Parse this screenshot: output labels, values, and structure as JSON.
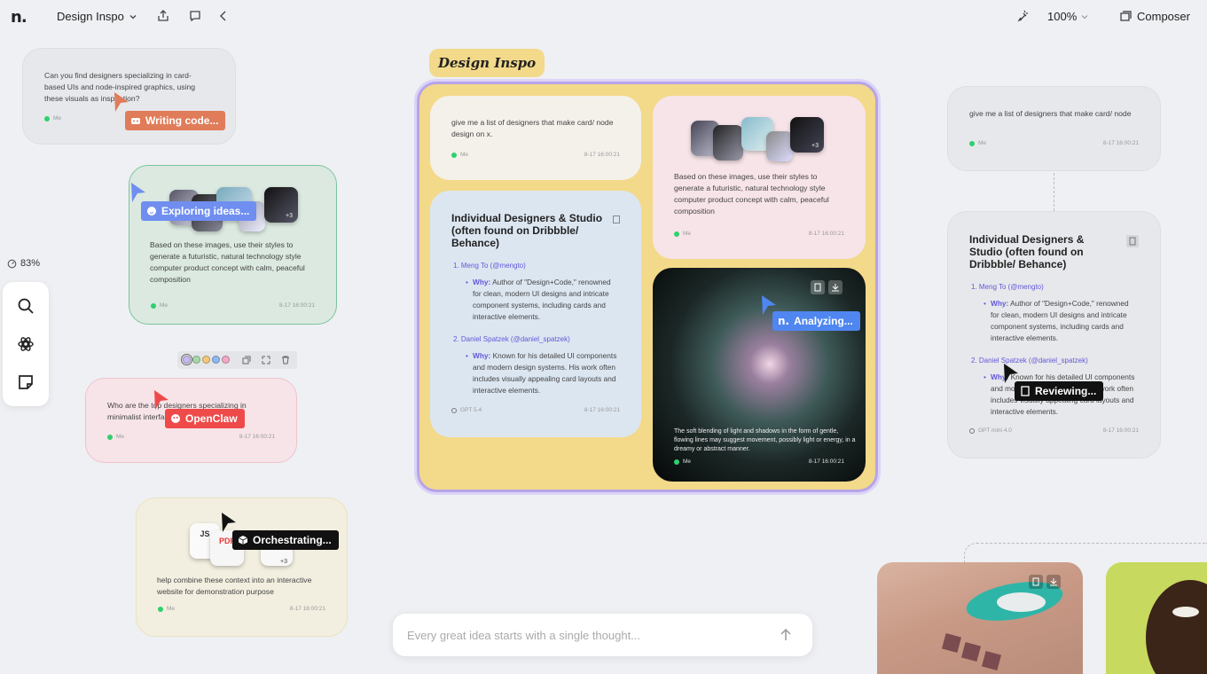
{
  "app": {
    "logo": "n.",
    "title": "Design Inspo"
  },
  "toolbar": {
    "zoom": "100%",
    "composer_label": "Composer"
  },
  "sidebar": {
    "zoom_percent": "83%"
  },
  "swatches": [
    "#c8b9f2",
    "#a8d8a8",
    "#f2c879",
    "#8fb8f0",
    "#f2a7c4"
  ],
  "cards": {
    "writing": {
      "text": "Can you find designers specializing in card-based UIs and node-inspired graphics, using these visuals as inspiration?",
      "author": "Me",
      "status": "Writing code..."
    },
    "exploring": {
      "text": "Based on these images, use their styles to generate a futuristic, natural technology style computer product concept with calm, peaceful composition",
      "author": "Me",
      "time": "8-17 16:00:21",
      "status": "Exploring ideas...",
      "more": "+3"
    },
    "openclaw": {
      "text": "Who are the top designers specializing in minimalist interfaces",
      "author": "Me",
      "time": "8-17 16:00:21",
      "status": "OpenClaw"
    },
    "orchestrating": {
      "text": "help combine these context into an interactive website for demonstration purpose",
      "author": "Me",
      "time": "8-17 16:00:21",
      "status": "Orchestrating...",
      "file1": "JS",
      "file2": "PDF",
      "more": "+3"
    }
  },
  "group": {
    "label": "Design Inspo",
    "prompt": {
      "text": "give me a list of designers that make card/ node design on x.",
      "author": "Me",
      "time": "8-17 16:00:21"
    },
    "answer": {
      "heading": "Individual Designers & Studio (often found on Dribbble/ Behance)",
      "items": [
        {
          "name": "1. Meng To (@mengto)",
          "why": "Why:",
          "text": "Author of \"Design+Code,\" renowned for clean, modern UI designs and intricate component systems, including cards and interactive elements."
        },
        {
          "name": "2. Daniel Spatzek (@daniel_spatzek)",
          "why": "Why:",
          "text": "Known for his detailed UI components and modern design systems. His work often includes visually appealing card layouts and interactive elements."
        }
      ],
      "model": "GPT 5.4",
      "time": "8-17 16:00:21"
    },
    "images_prompt": {
      "text": "Based on these images, use their styles to generate a futuristic, natural technology style computer product concept with calm, peaceful composition",
      "author": "Me",
      "time": "8-17 16:00:21",
      "more": "+3"
    },
    "image_result": {
      "caption": "The soft blending of light and shadows in the form of gentle, flowing lines may suggest movement, possibly light or energy, in a dreamy or abstract manner.",
      "author": "Me",
      "time": "8-17 16:00:21",
      "status": "Analyzing..."
    }
  },
  "right": {
    "prompt": {
      "text": "give me a list of designers that make card/ node",
      "author": "Me",
      "time": "8-17 16:00:21"
    },
    "answer": {
      "heading": "Individual Designers & Studio (often found on Dribbble/ Behance)",
      "items": [
        {
          "name": "1. Meng To (@mengto)",
          "why": "Why:",
          "text": "Author of \"Design+Code,\" renowned for clean, modern UI designs and intricate component systems, including cards and interactive elements."
        },
        {
          "name": "2. Daniel Spatzek (@daniel_spatzek)",
          "why": "Why:",
          "text": "Known for his detailed UI components and modern design systems. His work often includes visually appealing card layouts and interactive elements."
        }
      ],
      "model": "GPT mini 4.0",
      "time": "8-17 16:00:21",
      "status": "Reviewing..."
    }
  },
  "input": {
    "placeholder": "Every great idea starts with a single thought..."
  },
  "colors": {
    "group_bg": "#f3d98a",
    "accent": "#6357d8",
    "online": "#2fd06e"
  }
}
